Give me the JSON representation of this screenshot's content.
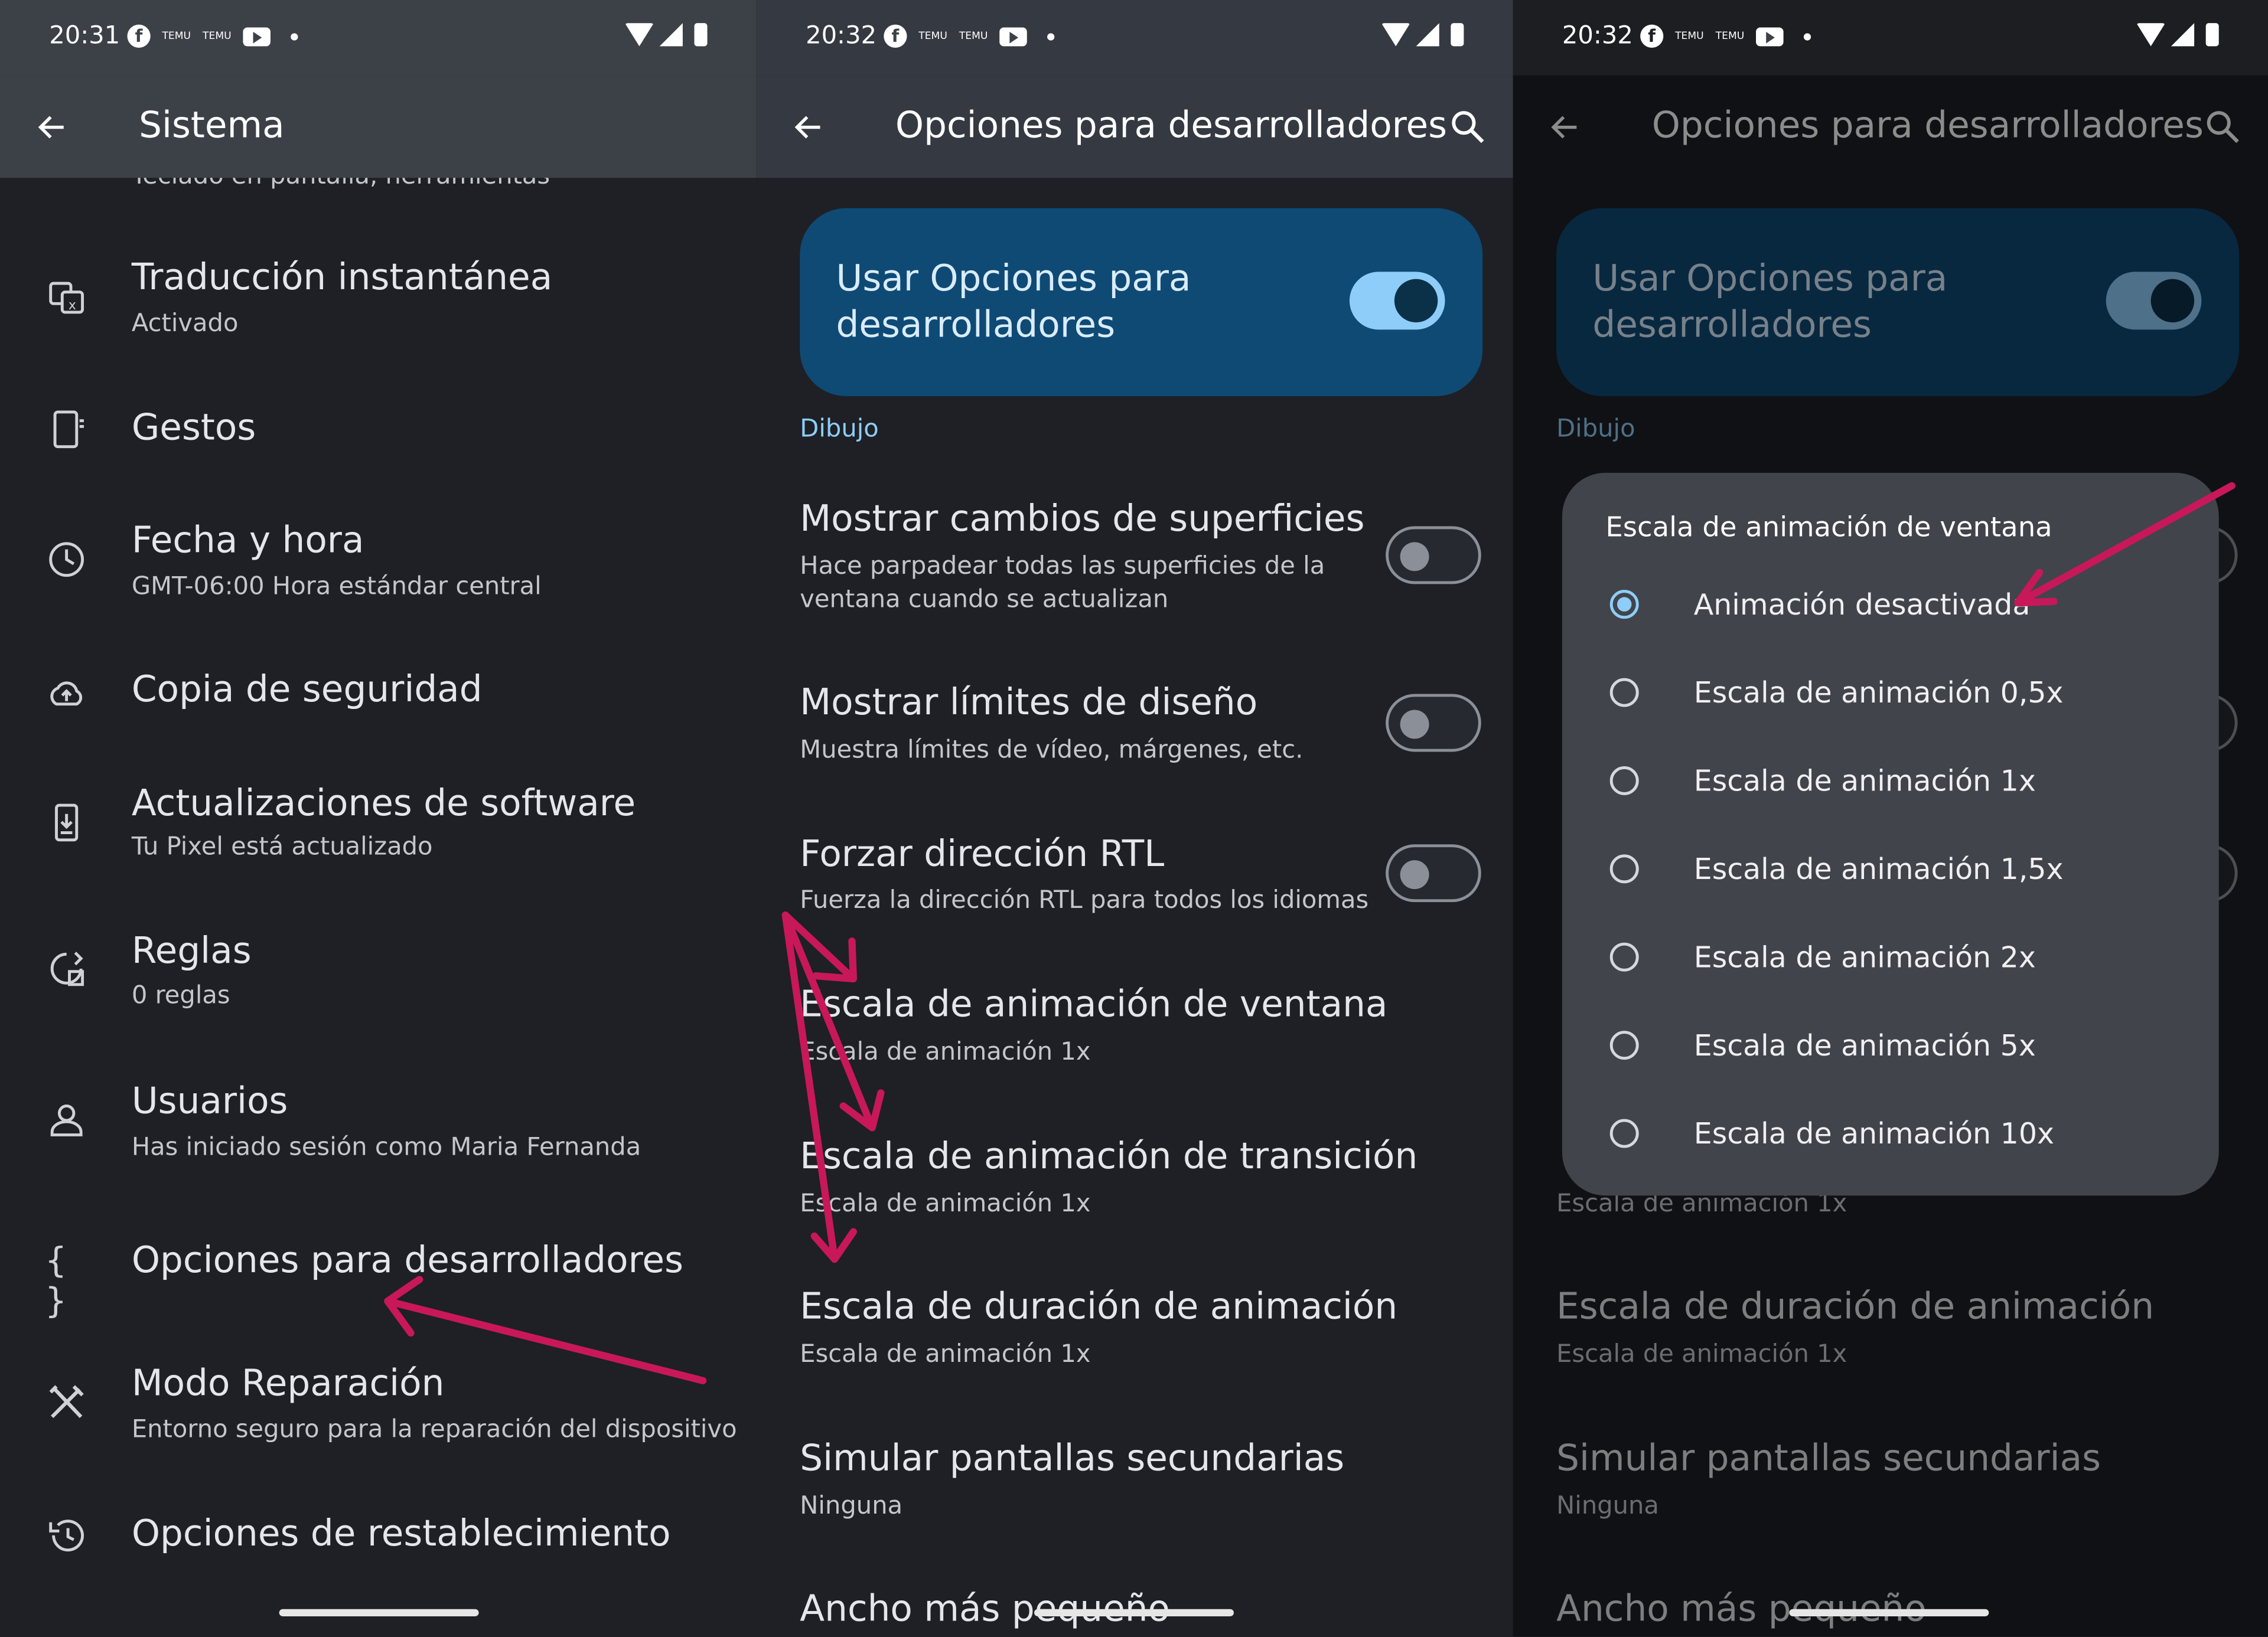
{
  "colors": {
    "background": "#1e2025",
    "appbar_p1": "#3c4148",
    "appbar_p2": "#353941",
    "accent": "#8ecdf9",
    "card": "#0f4a75",
    "dialog": "#41444b",
    "annotation_arrow": "#c8185a"
  },
  "panel1": {
    "status": {
      "time": "20:31",
      "temu": "TEMU"
    },
    "appbar": {
      "title": "Sistema"
    },
    "clipped_text": "Teclado en pantalla, herramientas",
    "items": [
      {
        "icon": "translate-icon",
        "title": "Traducción instantánea",
        "subtitle": "Activado"
      },
      {
        "icon": "gestures-icon",
        "title": "Gestos"
      },
      {
        "icon": "clock-icon",
        "title": "Fecha y hora",
        "subtitle": "GMT-06:00 Hora estándar central"
      },
      {
        "icon": "cloud-backup-icon",
        "title": "Copia de seguridad"
      },
      {
        "icon": "system-update-icon",
        "title": "Actualizaciones de software",
        "subtitle": "Tu Pixel está actualizado"
      },
      {
        "icon": "rules-icon",
        "title": "Reglas",
        "subtitle": "0 reglas"
      },
      {
        "icon": "person-icon",
        "title": "Usuarios",
        "subtitle": "Has iniciado sesión como Maria Fernanda"
      },
      {
        "icon": "code-braces-icon",
        "title": "Opciones para desarrolladores"
      },
      {
        "icon": "repair-tools-icon",
        "title": "Modo Reparación",
        "subtitle": "Entorno seguro para la reparación del dispositivo"
      },
      {
        "icon": "restore-icon",
        "title": "Opciones de restablecimiento"
      }
    ]
  },
  "panel2": {
    "status": {
      "time": "20:32",
      "temu": "TEMU"
    },
    "appbar": {
      "title": "Opciones para desarrolladores"
    },
    "master_toggle": {
      "label": "Usar Opciones para desarrolladores",
      "on": true
    },
    "section": "Dibujo",
    "items": [
      {
        "title": "Mostrar cambios de superficies",
        "subtitle": "Hace parpadear todas las superficies de la ventana cuando se actualizan",
        "toggle": false
      },
      {
        "title": "Mostrar límites de diseño",
        "subtitle": "Muestra límites de vídeo, márgenes, etc.",
        "toggle": false
      },
      {
        "title": "Forzar dirección RTL",
        "subtitle": "Fuerza la dirección RTL para todos los idiomas",
        "toggle": false
      },
      {
        "title": "Escala de animación de ventana",
        "subtitle": "Escala de animación 1x"
      },
      {
        "title": "Escala de animación de transición",
        "subtitle": "Escala de animación 1x"
      },
      {
        "title": "Escala de duración de animación",
        "subtitle": "Escala de animación 1x"
      },
      {
        "title": "Simular pantallas secundarias",
        "subtitle": "Ninguna"
      },
      {
        "title": "Ancho más pequeño"
      }
    ]
  },
  "panel3": {
    "status": {
      "time": "20:32",
      "temu": "TEMU"
    },
    "dialog": {
      "title": "Escala de animación de ventana",
      "selected_index": 0,
      "options": [
        "Animación desactivada",
        "Escala de animación 0,5x",
        "Escala de animación 1x",
        "Escala de animación 1,5x",
        "Escala de animación 2x",
        "Escala de animación 5x",
        "Escala de animación 10x"
      ]
    }
  }
}
